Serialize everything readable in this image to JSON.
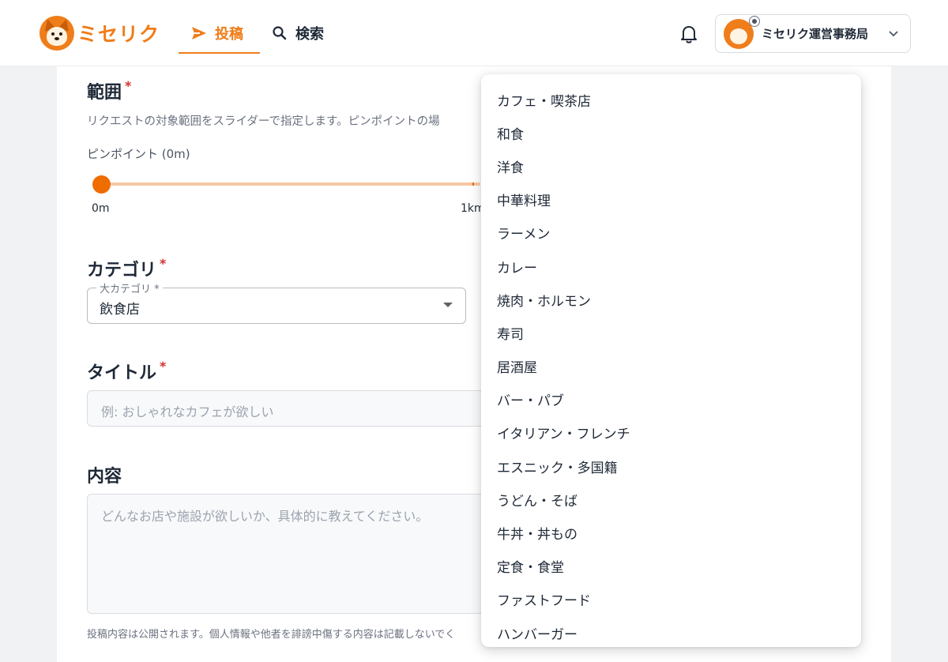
{
  "header": {
    "logo_text": "ミセリク",
    "tabs": [
      {
        "label": "投稿",
        "icon": "send-icon",
        "active": true
      },
      {
        "label": "検索",
        "icon": "search-icon",
        "active": false
      }
    ],
    "user_name": "ミセリク運営事務局"
  },
  "form": {
    "range": {
      "label": "範囲",
      "required_mark": "*",
      "description": "リクエストの対象範囲をスライダーで指定します。ピンポイントの場",
      "current_value": "ピンポイント (0m)",
      "tick_min": "0m",
      "tick_mid": "1km",
      "slider_fraction": 0
    },
    "category": {
      "label": "カテゴリ",
      "required_mark": "*",
      "field_label": "大カテゴリ *",
      "value": "飲食店"
    },
    "title": {
      "label": "タイトル",
      "required_mark": "*",
      "placeholder": "例: おしゃれなカフェが欲しい"
    },
    "content": {
      "label": "内容",
      "placeholder": "どんなお店や施設が欲しいか、具体的に教えてください。",
      "note": "投稿内容は公開されます。個人情報や他者を誹謗中傷する内容は記載しないでく"
    }
  },
  "dropdown": {
    "options": [
      "カフェ・喫茶店",
      "和食",
      "洋食",
      "中華料理",
      "ラーメン",
      "カレー",
      "焼肉・ホルモン",
      "寿司",
      "居酒屋",
      "バー・パブ",
      "イタリアン・フレンチ",
      "エスニック・多国籍",
      "うどん・そば",
      "牛丼・丼もの",
      "定食・食堂",
      "ファストフード",
      "ハンバーガー"
    ]
  },
  "colors": {
    "accent": "#ef7d1a",
    "required": "#d32f2f"
  }
}
